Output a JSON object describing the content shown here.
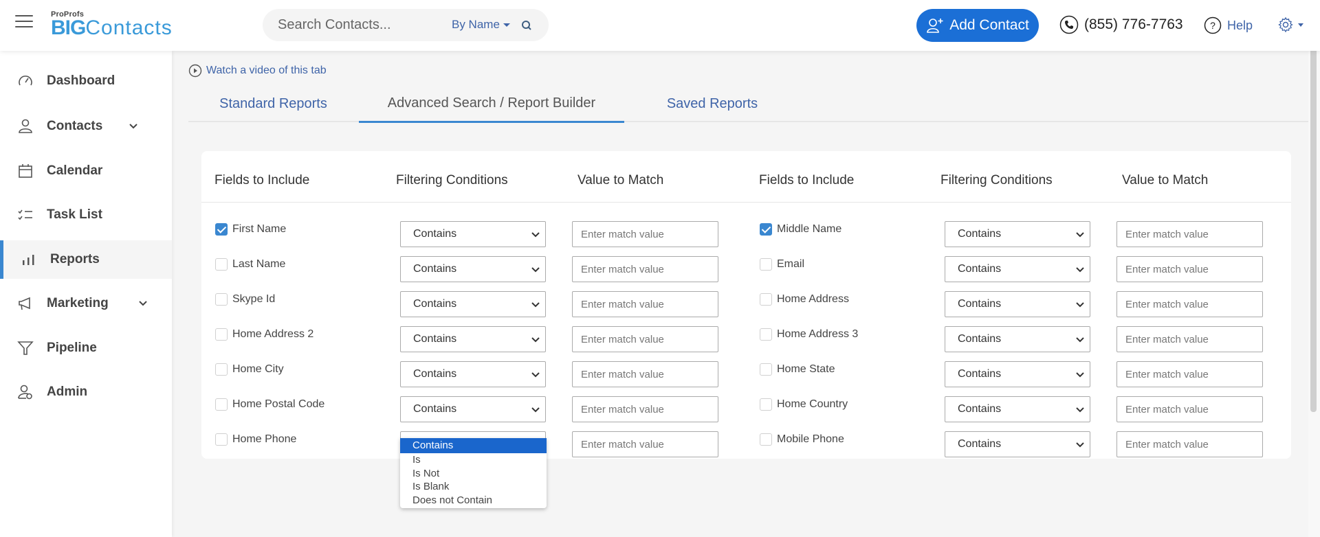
{
  "header": {
    "menu_icon": "hamburger-icon",
    "logo_top": "ProProfs",
    "logo_big": "BIG",
    "logo_rest": "Contacts",
    "search_placeholder": "Search Contacts...",
    "search_mode": "By Name",
    "add_contact_label": "Add Contact",
    "phone": "(855) 776-7763",
    "help_label": "Help"
  },
  "sidebar": {
    "items": [
      {
        "label": "Dashboard",
        "icon": "speedometer-icon",
        "has_chevron": false
      },
      {
        "label": "Contacts",
        "icon": "person-icon",
        "has_chevron": true
      },
      {
        "label": "Calendar",
        "icon": "calendar-icon",
        "has_chevron": false
      },
      {
        "label": "Task List",
        "icon": "checklist-icon",
        "has_chevron": false
      },
      {
        "label": "Reports",
        "icon": "bar-chart-icon",
        "has_chevron": false,
        "active": true
      },
      {
        "label": "Marketing",
        "icon": "megaphone-icon",
        "has_chevron": true
      },
      {
        "label": "Pipeline",
        "icon": "funnel-icon",
        "has_chevron": false
      },
      {
        "label": "Admin",
        "icon": "admin-user-icon",
        "has_chevron": false
      }
    ]
  },
  "main": {
    "watch_video": "Watch a video of this tab",
    "tabs": [
      {
        "label": "Standard Reports",
        "active": false
      },
      {
        "label": "Advanced Search / Report Builder",
        "active": true
      },
      {
        "label": "Saved Reports",
        "active": false
      }
    ],
    "columns": [
      "Fields to Include",
      "Filtering Conditions",
      "Value to Match",
      "Fields to Include",
      "Filtering Conditions",
      "Value to Match"
    ],
    "input_placeholder": "Enter match value",
    "left_fields": [
      {
        "label": "First Name",
        "checked": true,
        "condition": "Contains"
      },
      {
        "label": "Last Name",
        "checked": false,
        "condition": "Contains"
      },
      {
        "label": "Skype Id",
        "checked": false,
        "condition": "Contains"
      },
      {
        "label": "Home Address 2",
        "checked": false,
        "condition": "Contains"
      },
      {
        "label": "Home City",
        "checked": false,
        "condition": "Contains"
      },
      {
        "label": "Home Postal Code",
        "checked": false,
        "condition": "Contains"
      },
      {
        "label": "Home Phone",
        "checked": false,
        "condition": "Contains"
      }
    ],
    "right_fields": [
      {
        "label": "Middle Name",
        "checked": true,
        "condition": "Contains"
      },
      {
        "label": "Email",
        "checked": false,
        "condition": "Contains"
      },
      {
        "label": "Home Address",
        "checked": false,
        "condition": "Contains"
      },
      {
        "label": "Home Address 3",
        "checked": false,
        "condition": "Contains"
      },
      {
        "label": "Home State",
        "checked": false,
        "condition": "Contains"
      },
      {
        "label": "Home Country",
        "checked": false,
        "condition": "Contains"
      },
      {
        "label": "Mobile Phone",
        "checked": false,
        "condition": "Contains"
      }
    ],
    "open_dropdown": {
      "for_field": "Home Phone",
      "options": [
        "Contains",
        "Is",
        "Is Not",
        "Is Blank",
        "Does not Contain"
      ],
      "highlighted": "Contains"
    }
  },
  "colors": {
    "brand_blue": "#3a9ad9",
    "primary_button": "#1b6fd6",
    "link_blue": "#3f64a8",
    "active_accent": "#3a87d0",
    "dropdown_highlight": "#1a66cc"
  }
}
